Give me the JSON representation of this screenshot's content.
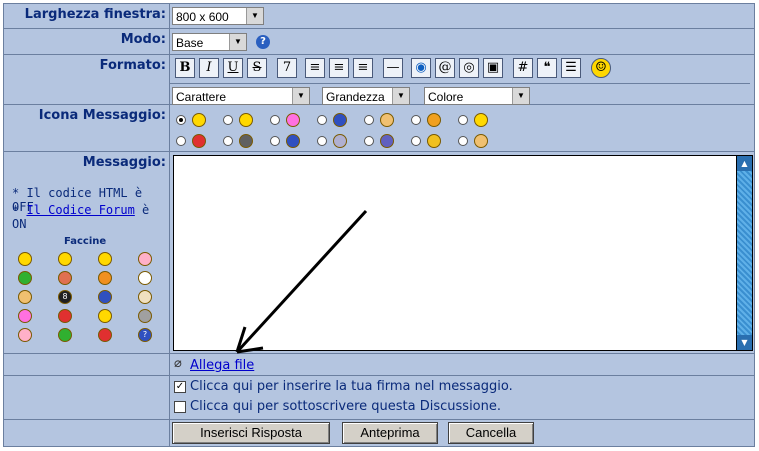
{
  "labels": {
    "window_width": "Larghezza finestra:",
    "mode": "Modo:",
    "format": "Formato:",
    "message_icon": "Icona Messaggio:",
    "message": "Messaggio:"
  },
  "window_width": {
    "value": "800 x 600"
  },
  "mode": {
    "value": "Base"
  },
  "format_toolbar": {
    "buttons": [
      "B",
      "I",
      "U",
      "S",
      "7",
      "left",
      "center",
      "right",
      "hr",
      "globe",
      "email",
      "cd",
      "image",
      "#",
      "quote",
      "list",
      "smile"
    ]
  },
  "format_selects": {
    "font": "Carattere",
    "size": "Grandezza",
    "color": "Colore"
  },
  "message_notes": {
    "html_prefix": "* Il codice HTML è OFF",
    "forum_prefix": "* ",
    "forum_link": "Il Codice Forum",
    "forum_suffix": " è ON"
  },
  "smilies": {
    "title": "Faccine",
    "colors": [
      "#ffd800",
      "#ffd800",
      "#ffd800",
      "#ffb0c8",
      "#30b030",
      "#e07050",
      "#f09020",
      "#ffffff",
      "#f0c070",
      "#202020",
      "#3050c0",
      "#f0e0c0",
      "#ff70e0",
      "#e03030",
      "#ffd800",
      "#a0a0a0",
      "#ffb0c8",
      "#30b030",
      "#e03030",
      "#3050c0"
    ]
  },
  "attach": {
    "label": "Allega file"
  },
  "options": {
    "signature": "Clicca qui per inserire la tua firma nel messaggio.",
    "subscribe": "Clicca qui per sottoscrivere questa Discussione."
  },
  "buttons": {
    "submit": "Inserisci Risposta",
    "preview": "Anteprima",
    "cancel": "Cancella"
  }
}
